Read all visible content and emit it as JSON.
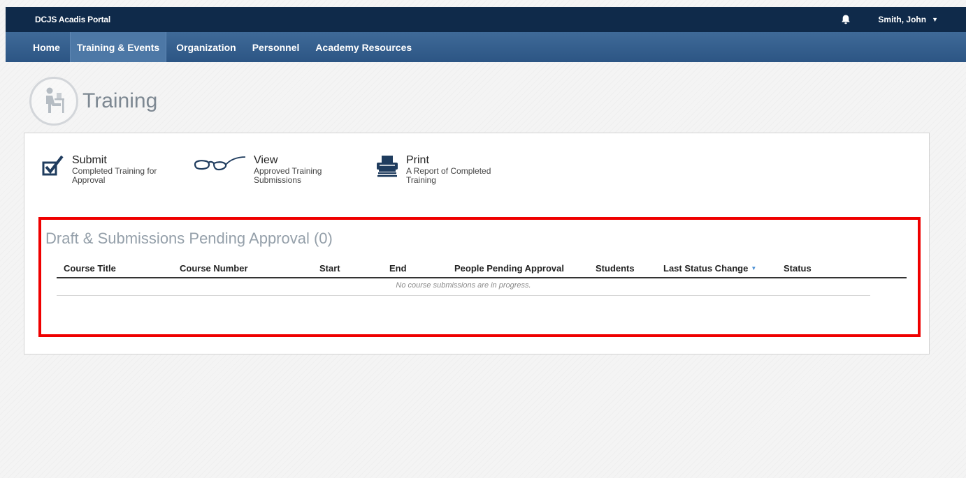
{
  "header": {
    "portal_title": "DCJS Acadis Portal",
    "user_name": "Smith, John",
    "notification_icon": "bell-icon"
  },
  "nav": {
    "items": [
      {
        "label": "Home"
      },
      {
        "label": "Training & Events",
        "active": true
      },
      {
        "label": "Organization"
      },
      {
        "label": "Personnel"
      },
      {
        "label": "Academy Resources"
      }
    ]
  },
  "page": {
    "title": "Training",
    "icon": "person-at-desk-icon"
  },
  "actions": [
    {
      "title": "Submit",
      "subtitle": "Completed Training for Approval",
      "icon": "checkbox-check-icon"
    },
    {
      "title": "View",
      "subtitle": "Approved Training Submissions",
      "icon": "glasses-icon"
    },
    {
      "title": "Print",
      "subtitle": "A Report of Completed Training",
      "icon": "printer-icon"
    }
  ],
  "pending": {
    "title": "Draft & Submissions Pending Approval (0)",
    "columns": [
      "Course Title",
      "Course Number",
      "Start",
      "End",
      "People Pending Approval",
      "Students",
      "Last Status Change",
      "Status"
    ],
    "sorted_column": "Last Status Change",
    "empty_message": "No course submissions are in progress."
  },
  "colors": {
    "topbar": "#0f2a4a",
    "navbar": "#2c5584",
    "highlight": "#ef0000",
    "sort_indicator": "#4a8fd3"
  }
}
